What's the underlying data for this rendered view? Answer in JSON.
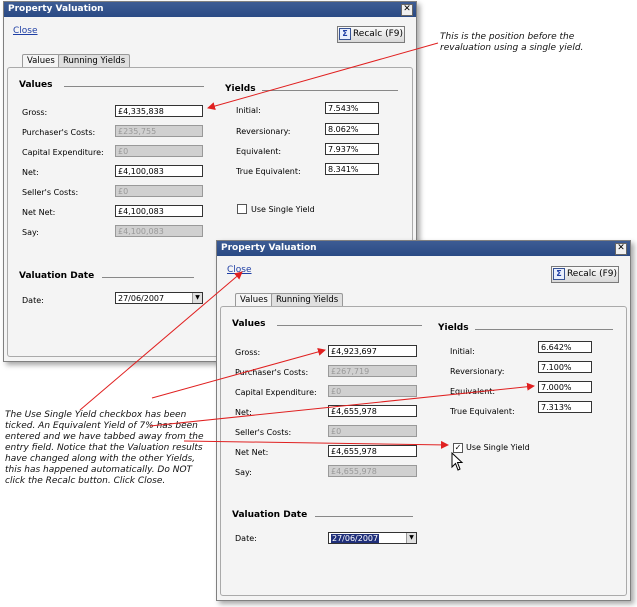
{
  "w1": {
    "title": "Property Valuation",
    "close_link": "Close",
    "recalc_label": "Recalc (F9)",
    "tabs": [
      "Values",
      "Running Yields"
    ],
    "values_header": "Values",
    "yields_header": "Yields",
    "valuation_date_header": "Valuation Date",
    "rows": [
      {
        "label": "Gross:",
        "value": "£4,335,838"
      },
      {
        "label": "Purchaser's Costs:",
        "value": "£235,755"
      },
      {
        "label": "Capital Expenditure:",
        "value": "£0"
      },
      {
        "label": "Net:",
        "value": "£4,100,083"
      },
      {
        "label": "Seller's Costs:",
        "value": "£0"
      },
      {
        "label": "Net Net:",
        "value": "£4,100,083"
      },
      {
        "label": "Say:",
        "value": "£4,100,083"
      }
    ],
    "yields": [
      {
        "label": "Initial:",
        "value": "7.543%"
      },
      {
        "label": "Reversionary:",
        "value": "8.062%"
      },
      {
        "label": "Equivalent:",
        "value": "7.937%"
      },
      {
        "label": "True Equivalent:",
        "value": "8.341%"
      }
    ],
    "use_single_yield": "Use Single Yield",
    "date_label": "Date:",
    "date_value": "27/06/2007"
  },
  "w2": {
    "title": "Property Valuation",
    "close_link": "Close",
    "recalc_label": "Recalc (F9)",
    "tabs": [
      "Values",
      "Running Yields"
    ],
    "values_header": "Values",
    "yields_header": "Yields",
    "valuation_date_header": "Valuation Date",
    "rows": [
      {
        "label": "Gross:",
        "value": "£4,923,697"
      },
      {
        "label": "Purchaser's Costs:",
        "value": "£267,719"
      },
      {
        "label": "Capital Expenditure:",
        "value": "£0"
      },
      {
        "label": "Net:",
        "value": "£4,655,978"
      },
      {
        "label": "Seller's Costs:",
        "value": "£0"
      },
      {
        "label": "Net Net:",
        "value": "£4,655,978"
      },
      {
        "label": "Say:",
        "value": "£4,655,978"
      }
    ],
    "yields": [
      {
        "label": "Initial:",
        "value": "6.642%"
      },
      {
        "label": "Reversionary:",
        "value": "7.100%"
      },
      {
        "label": "Equivalent:",
        "value": "7.000%"
      },
      {
        "label": "True Equivalent:",
        "value": "7.313%"
      }
    ],
    "use_single_yield": "Use Single Yield",
    "date_label": "Date:",
    "date_value": "27/06/2007"
  },
  "annotations": {
    "top_right": "This is the position before the revaluation using a single yield.",
    "left_note": "The Use Single Yield checkbox has been ticked. An Equivalent Yield of 7% has been entered and we have tabbed away from the entry field. Notice that the Valuation results have changed along with the other Yields, this has happened automatically. Do NOT click the Recalc button. Click Close."
  },
  "colors": {
    "titlebar": "#2a4a85",
    "link": "#1f3fa5",
    "arrow": "#e02020",
    "selected_date": "#1f2f7a"
  }
}
